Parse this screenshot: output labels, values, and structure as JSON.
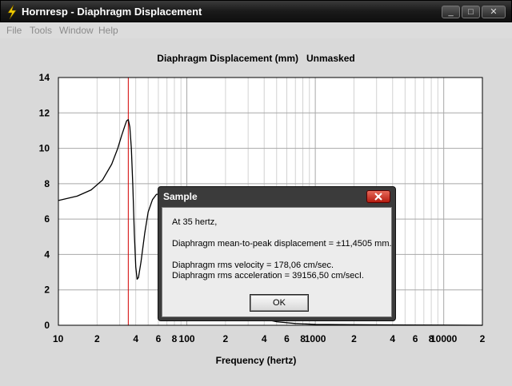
{
  "window": {
    "title": "Hornresp - Diaphragm Displacement",
    "controls": {
      "minimize": "_",
      "maximize": "□",
      "close": "✕"
    }
  },
  "menu": [
    "File",
    "Tools",
    "Window",
    "Help"
  ],
  "chart_data": {
    "type": "line",
    "title": "Diaphragm Displacement (mm)   Unmasked",
    "xlabel": "Frequency (hertz)",
    "ylabel": "",
    "xscale": "log",
    "xlim": [
      10,
      20000
    ],
    "ylim": [
      0,
      14
    ],
    "yticks": [
      0,
      2,
      4,
      6,
      8,
      10,
      12,
      14
    ],
    "xtick_labels": [
      {
        "v": 10,
        "t": "10"
      },
      {
        "v": 20,
        "t": "2"
      },
      {
        "v": 40,
        "t": "4"
      },
      {
        "v": 60,
        "t": "6"
      },
      {
        "v": 80,
        "t": "8"
      },
      {
        "v": 100,
        "t": "100"
      },
      {
        "v": 200,
        "t": "2"
      },
      {
        "v": 400,
        "t": "4"
      },
      {
        "v": 600,
        "t": "6"
      },
      {
        "v": 800,
        "t": "8"
      },
      {
        "v": 1000,
        "t": "1000"
      },
      {
        "v": 2000,
        "t": "2"
      },
      {
        "v": 4000,
        "t": "4"
      },
      {
        "v": 6000,
        "t": "6"
      },
      {
        "v": 8000,
        "t": "8"
      },
      {
        "v": 10000,
        "t": "10000"
      },
      {
        "v": 20000,
        "t": "2"
      }
    ],
    "grid": true,
    "marker_frequency": 35,
    "series": [
      {
        "color": "#000000",
        "x": [
          10,
          14,
          18,
          22,
          26,
          29,
          31,
          33,
          34,
          35,
          36,
          37,
          38,
          39,
          40,
          41,
          42,
          44,
          47,
          50,
          54,
          58,
          62,
          66,
          70,
          80,
          90,
          100,
          120,
          150,
          200,
          300,
          400,
          500,
          700,
          1000,
          2000,
          5000,
          10000,
          20000
        ],
        "y": [
          7.05,
          7.3,
          7.65,
          8.2,
          9.1,
          10.0,
          10.7,
          11.3,
          11.55,
          11.62,
          11.2,
          10.0,
          7.8,
          5.2,
          3.3,
          2.6,
          2.7,
          3.6,
          5.2,
          6.4,
          7.1,
          7.4,
          7.4,
          7.2,
          6.9,
          6.0,
          5.2,
          4.5,
          3.4,
          2.4,
          1.5,
          0.7,
          0.35,
          0.2,
          0.1,
          0.05,
          0.03,
          0.02,
          0.01,
          0.0
        ]
      }
    ],
    "marker_color": "#d40000"
  },
  "dialog": {
    "title": "Sample",
    "line1": "At 35 hertz,",
    "line2": "Diaphragm mean-to-peak displacement = ±11,4505 mm.",
    "line3": "Diaphragm rms velocity = 178,06 cm/sec.",
    "line4": "Diaphragm rms acceleration = 39156,50 cm/secI.",
    "ok_label": "OK",
    "close_symbol": "✕"
  }
}
